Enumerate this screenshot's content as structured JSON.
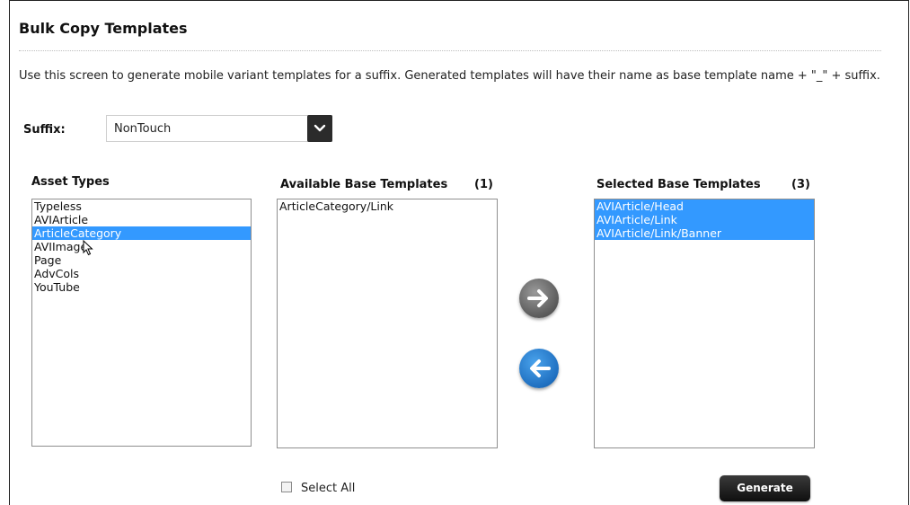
{
  "page": {
    "title": "Bulk Copy Templates",
    "description": "Use this screen to generate mobile variant templates for a suffix. Generated templates will have their name as base template name + \"_\" + suffix."
  },
  "suffix": {
    "label": "Suffix:",
    "value": "NonTouch"
  },
  "asset_types": {
    "header": "Asset Types",
    "items": [
      {
        "label": "Typeless",
        "selected": false
      },
      {
        "label": "AVIArticle",
        "selected": false
      },
      {
        "label": "ArticleCategory",
        "selected": true
      },
      {
        "label": "AVIImage",
        "selected": false
      },
      {
        "label": "Page",
        "selected": false
      },
      {
        "label": "AdvCols",
        "selected": false
      },
      {
        "label": "YouTube",
        "selected": false
      }
    ]
  },
  "available": {
    "header": "Available Base Templates",
    "count": "(1)",
    "items": [
      {
        "label": "ArticleCategory/Link",
        "selected": false
      }
    ]
  },
  "selected": {
    "header": "Selected Base Templates",
    "count": "(3)",
    "items": [
      {
        "label": "AVIArticle/Head",
        "selected": true
      },
      {
        "label": "AVIArticle/Link",
        "selected": true
      },
      {
        "label": "AVIArticle/Link/Banner",
        "selected": true
      }
    ]
  },
  "controls": {
    "select_all_label": "Select All",
    "generate_label": "Generate"
  },
  "colors": {
    "selection": "#3399ff",
    "move_right": "#6b6b6b",
    "move_left": "#1f6fc0",
    "generate_bg": "#1a1a1a"
  },
  "icons": {
    "move_right": "arrow-right-icon",
    "move_left": "arrow-left-icon",
    "dropdown": "chevron-down-icon"
  }
}
